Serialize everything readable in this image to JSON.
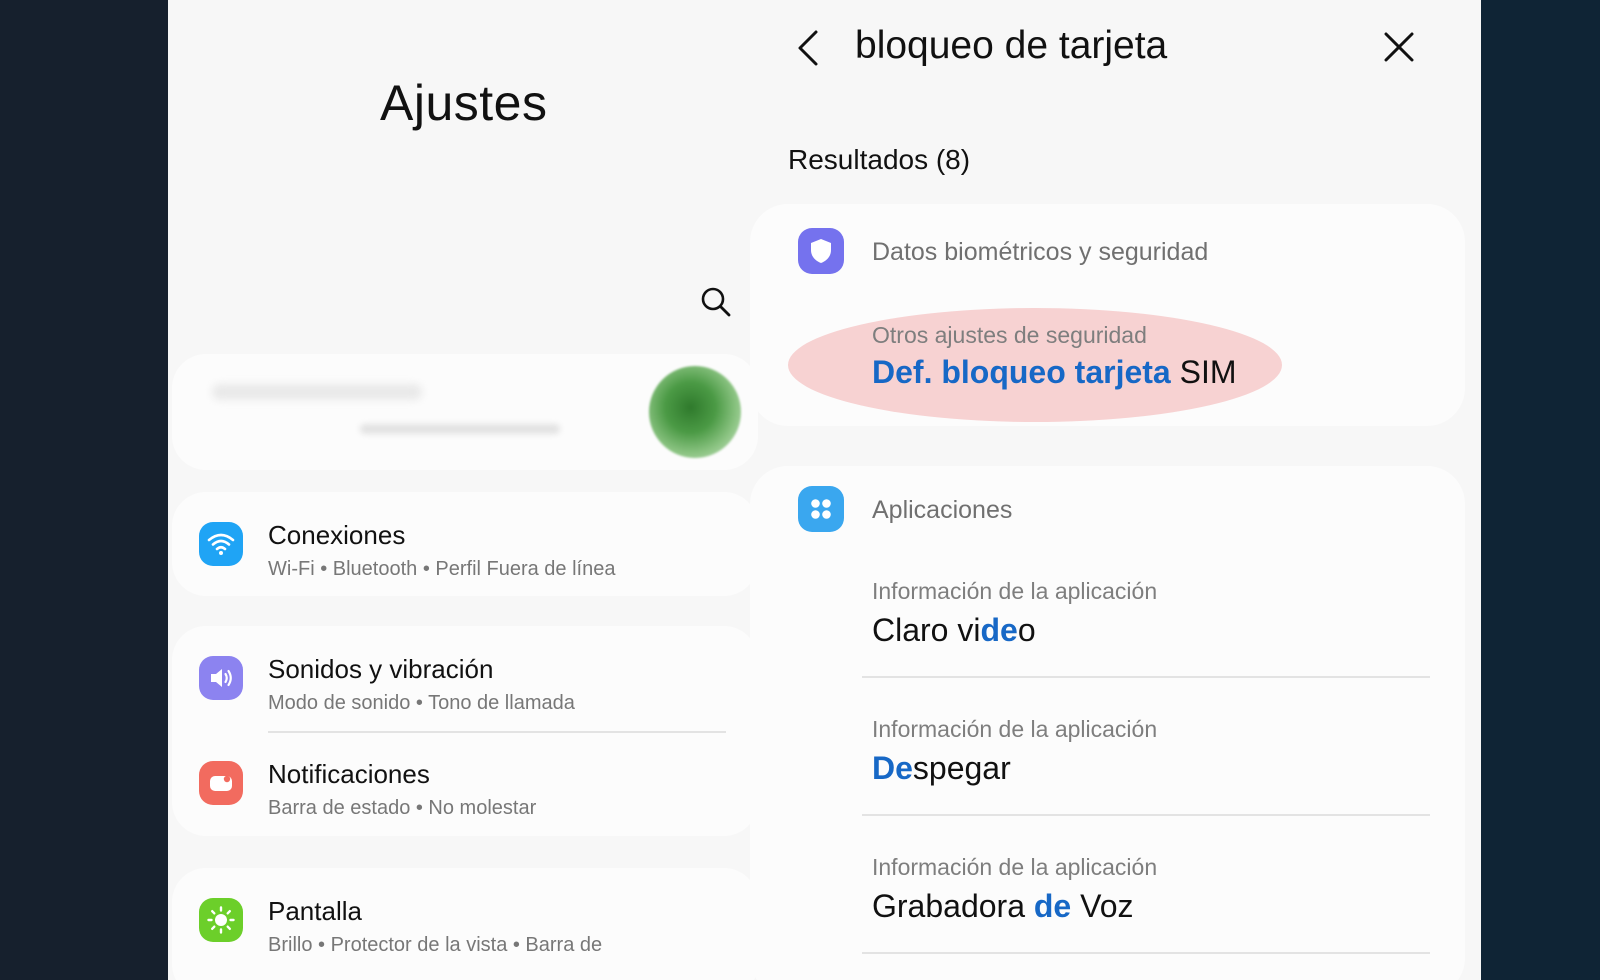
{
  "settings": {
    "title": "Ajustes",
    "items": [
      {
        "title": "Conexiones",
        "subtitle": "Wi-Fi  •  Bluetooth  •  Perfil Fuera de línea",
        "icon": "wifi-icon",
        "color": "#1fa4f5"
      },
      {
        "title": "Sonidos y vibración",
        "subtitle": "Modo de sonido  •  Tono de llamada",
        "icon": "volume-icon",
        "color": "#8c83f0"
      },
      {
        "title": "Notificaciones",
        "subtitle": "Barra de estado  •  No molestar",
        "icon": "notification-icon",
        "color": "#f26b5f"
      },
      {
        "title": "Pantalla",
        "subtitle": "Brillo  •  Protector de la vista  •  Barra de",
        "icon": "sun-icon",
        "color": "#6ccf2a"
      }
    ]
  },
  "search": {
    "query": "bloqueo de tarjeta",
    "results_label": "Resultados (8)",
    "categories": [
      {
        "title": "Datos biométricos y seguridad",
        "icon": "shield-icon",
        "color": "#7572ee",
        "results": [
          {
            "subtitle": "Otros ajustes de seguridad",
            "title_parts": [
              "Def.",
              "bloqueo",
              "tarjeta",
              "SIM"
            ]
          }
        ]
      },
      {
        "title": "Aplicaciones",
        "icon": "apps-icon",
        "color": "#3aa7ef",
        "results": [
          {
            "subtitle": "Información de la aplicación",
            "title_parts": [
              "Claro vi",
              "de",
              "o"
            ]
          },
          {
            "subtitle": "Información de la aplicación",
            "title_parts": [
              "De",
              "spegar"
            ]
          },
          {
            "subtitle": "Información de la aplicación",
            "title_parts": [
              "Grabadora ",
              "de",
              " Voz"
            ]
          }
        ]
      }
    ]
  },
  "colors": {
    "highlight": "#1768c6",
    "circle": "#f7d2d2"
  }
}
